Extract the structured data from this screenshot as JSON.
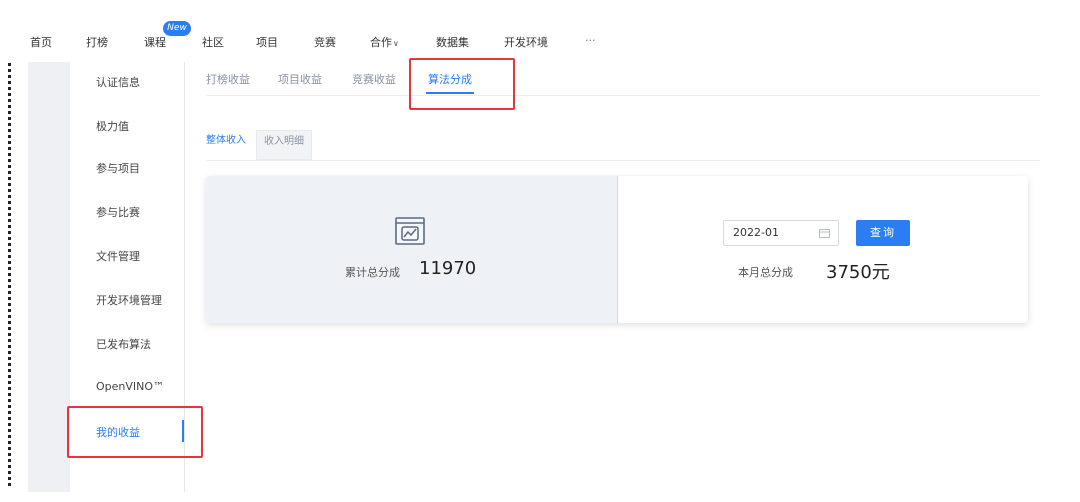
{
  "nav": {
    "home": "首页",
    "rank": "打榜",
    "course": "课程",
    "course_badge": "New",
    "community": "社区",
    "project": "项目",
    "competition": "竞赛",
    "cooperate": "合作",
    "dataset": "数据集",
    "devenv": "开发环境",
    "more": "···"
  },
  "sidebar": {
    "items": [
      {
        "label": "认证信息"
      },
      {
        "label": "极力值"
      },
      {
        "label": "参与项目"
      },
      {
        "label": "参与比赛"
      },
      {
        "label": "文件管理"
      },
      {
        "label": "开发环境管理"
      },
      {
        "label": "已发布算法"
      },
      {
        "label": "OpenVINO™"
      },
      {
        "label": "我的收益"
      }
    ],
    "active_index": 8
  },
  "tabs": [
    {
      "label": "打榜收益"
    },
    {
      "label": "项目收益"
    },
    {
      "label": "竞赛收益"
    },
    {
      "label": "算法分成"
    }
  ],
  "subtabs": [
    {
      "label": "整体收入"
    },
    {
      "label": "收入明细"
    }
  ],
  "summary": {
    "total_label": "累计总分成",
    "total_value": "11970",
    "date_value": "2022-01",
    "query_label": "查询",
    "month_label": "本月总分成",
    "month_value": "3750元"
  },
  "colors": {
    "accent": "#2b7df4",
    "annotation": "#e8343c"
  },
  "icons": {
    "summary": "chart-icon",
    "date": "calendar-icon"
  }
}
